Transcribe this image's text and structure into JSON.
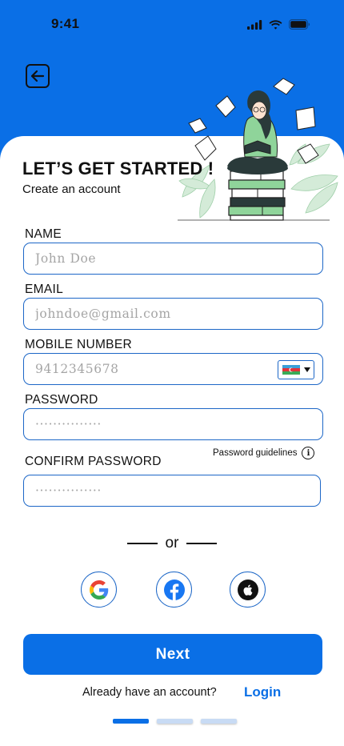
{
  "status_bar": {
    "time": "9:41"
  },
  "header": {
    "title": "LET’S GET STARTED !",
    "subtitle": "Create an account"
  },
  "form": {
    "name": {
      "label": "NAME",
      "placeholder": "John Doe"
    },
    "email": {
      "label": "EMAIL",
      "placeholder": "johndoe@gmail.com"
    },
    "mobile": {
      "label": "MOBILE NUMBER",
      "placeholder": "9412345678",
      "country_flag": "azerbaijan-flag"
    },
    "password": {
      "label": "PASSWORD",
      "placeholder": "···············"
    },
    "password_guidelines": "Password guidelines",
    "confirm_password": {
      "label": "CONFIRM PASSWORD",
      "placeholder": "···············"
    }
  },
  "divider_text": "or",
  "social": [
    "google-icon",
    "facebook-icon",
    "apple-icon"
  ],
  "next_label": "Next",
  "login_prompt": "Already have an account?",
  "login_label": "Login",
  "pager": {
    "pages": 3,
    "active": 0
  },
  "colors": {
    "primary": "#0a6fe6",
    "field_border": "#1d67c7",
    "background": "#ffffff"
  }
}
